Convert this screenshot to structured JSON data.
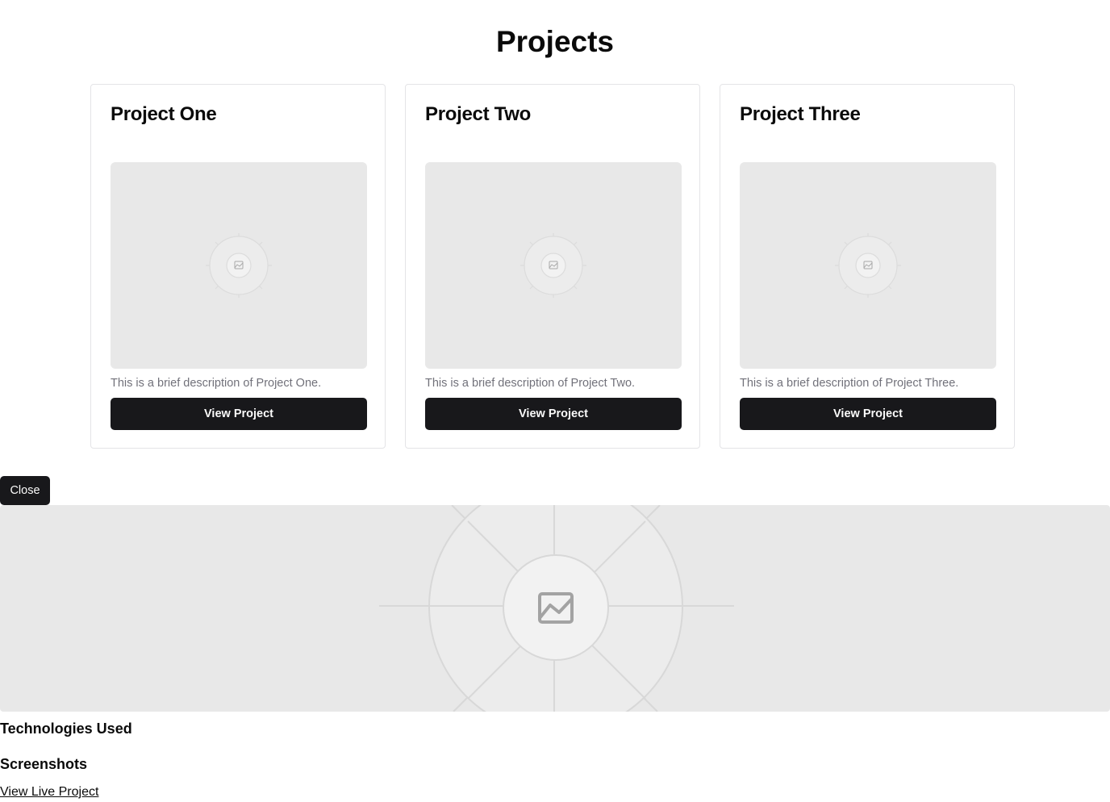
{
  "page": {
    "title": "Projects"
  },
  "projects": [
    {
      "title": "Project One",
      "description": "This is a brief description of Project One.",
      "button_label": "View Project",
      "image_icon": "image-placeholder-icon"
    },
    {
      "title": "Project Two",
      "description": "This is a brief description of Project Two.",
      "button_label": "View Project",
      "image_icon": "image-placeholder-icon"
    },
    {
      "title": "Project Three",
      "description": "This is a brief description of Project Three.",
      "button_label": "View Project",
      "image_icon": "image-placeholder-icon"
    }
  ],
  "detail": {
    "close_label": "Close",
    "hero_icon": "image-placeholder-icon",
    "technologies_heading": "Technologies Used",
    "screenshots_heading": "Screenshots",
    "live_link_label": "View Live Project"
  },
  "colors": {
    "button_bg": "#18181b",
    "button_text": "#fafafa",
    "placeholder_bg": "#e8e8e8",
    "muted_text": "#71717a",
    "card_border": "#e4e4e7"
  }
}
